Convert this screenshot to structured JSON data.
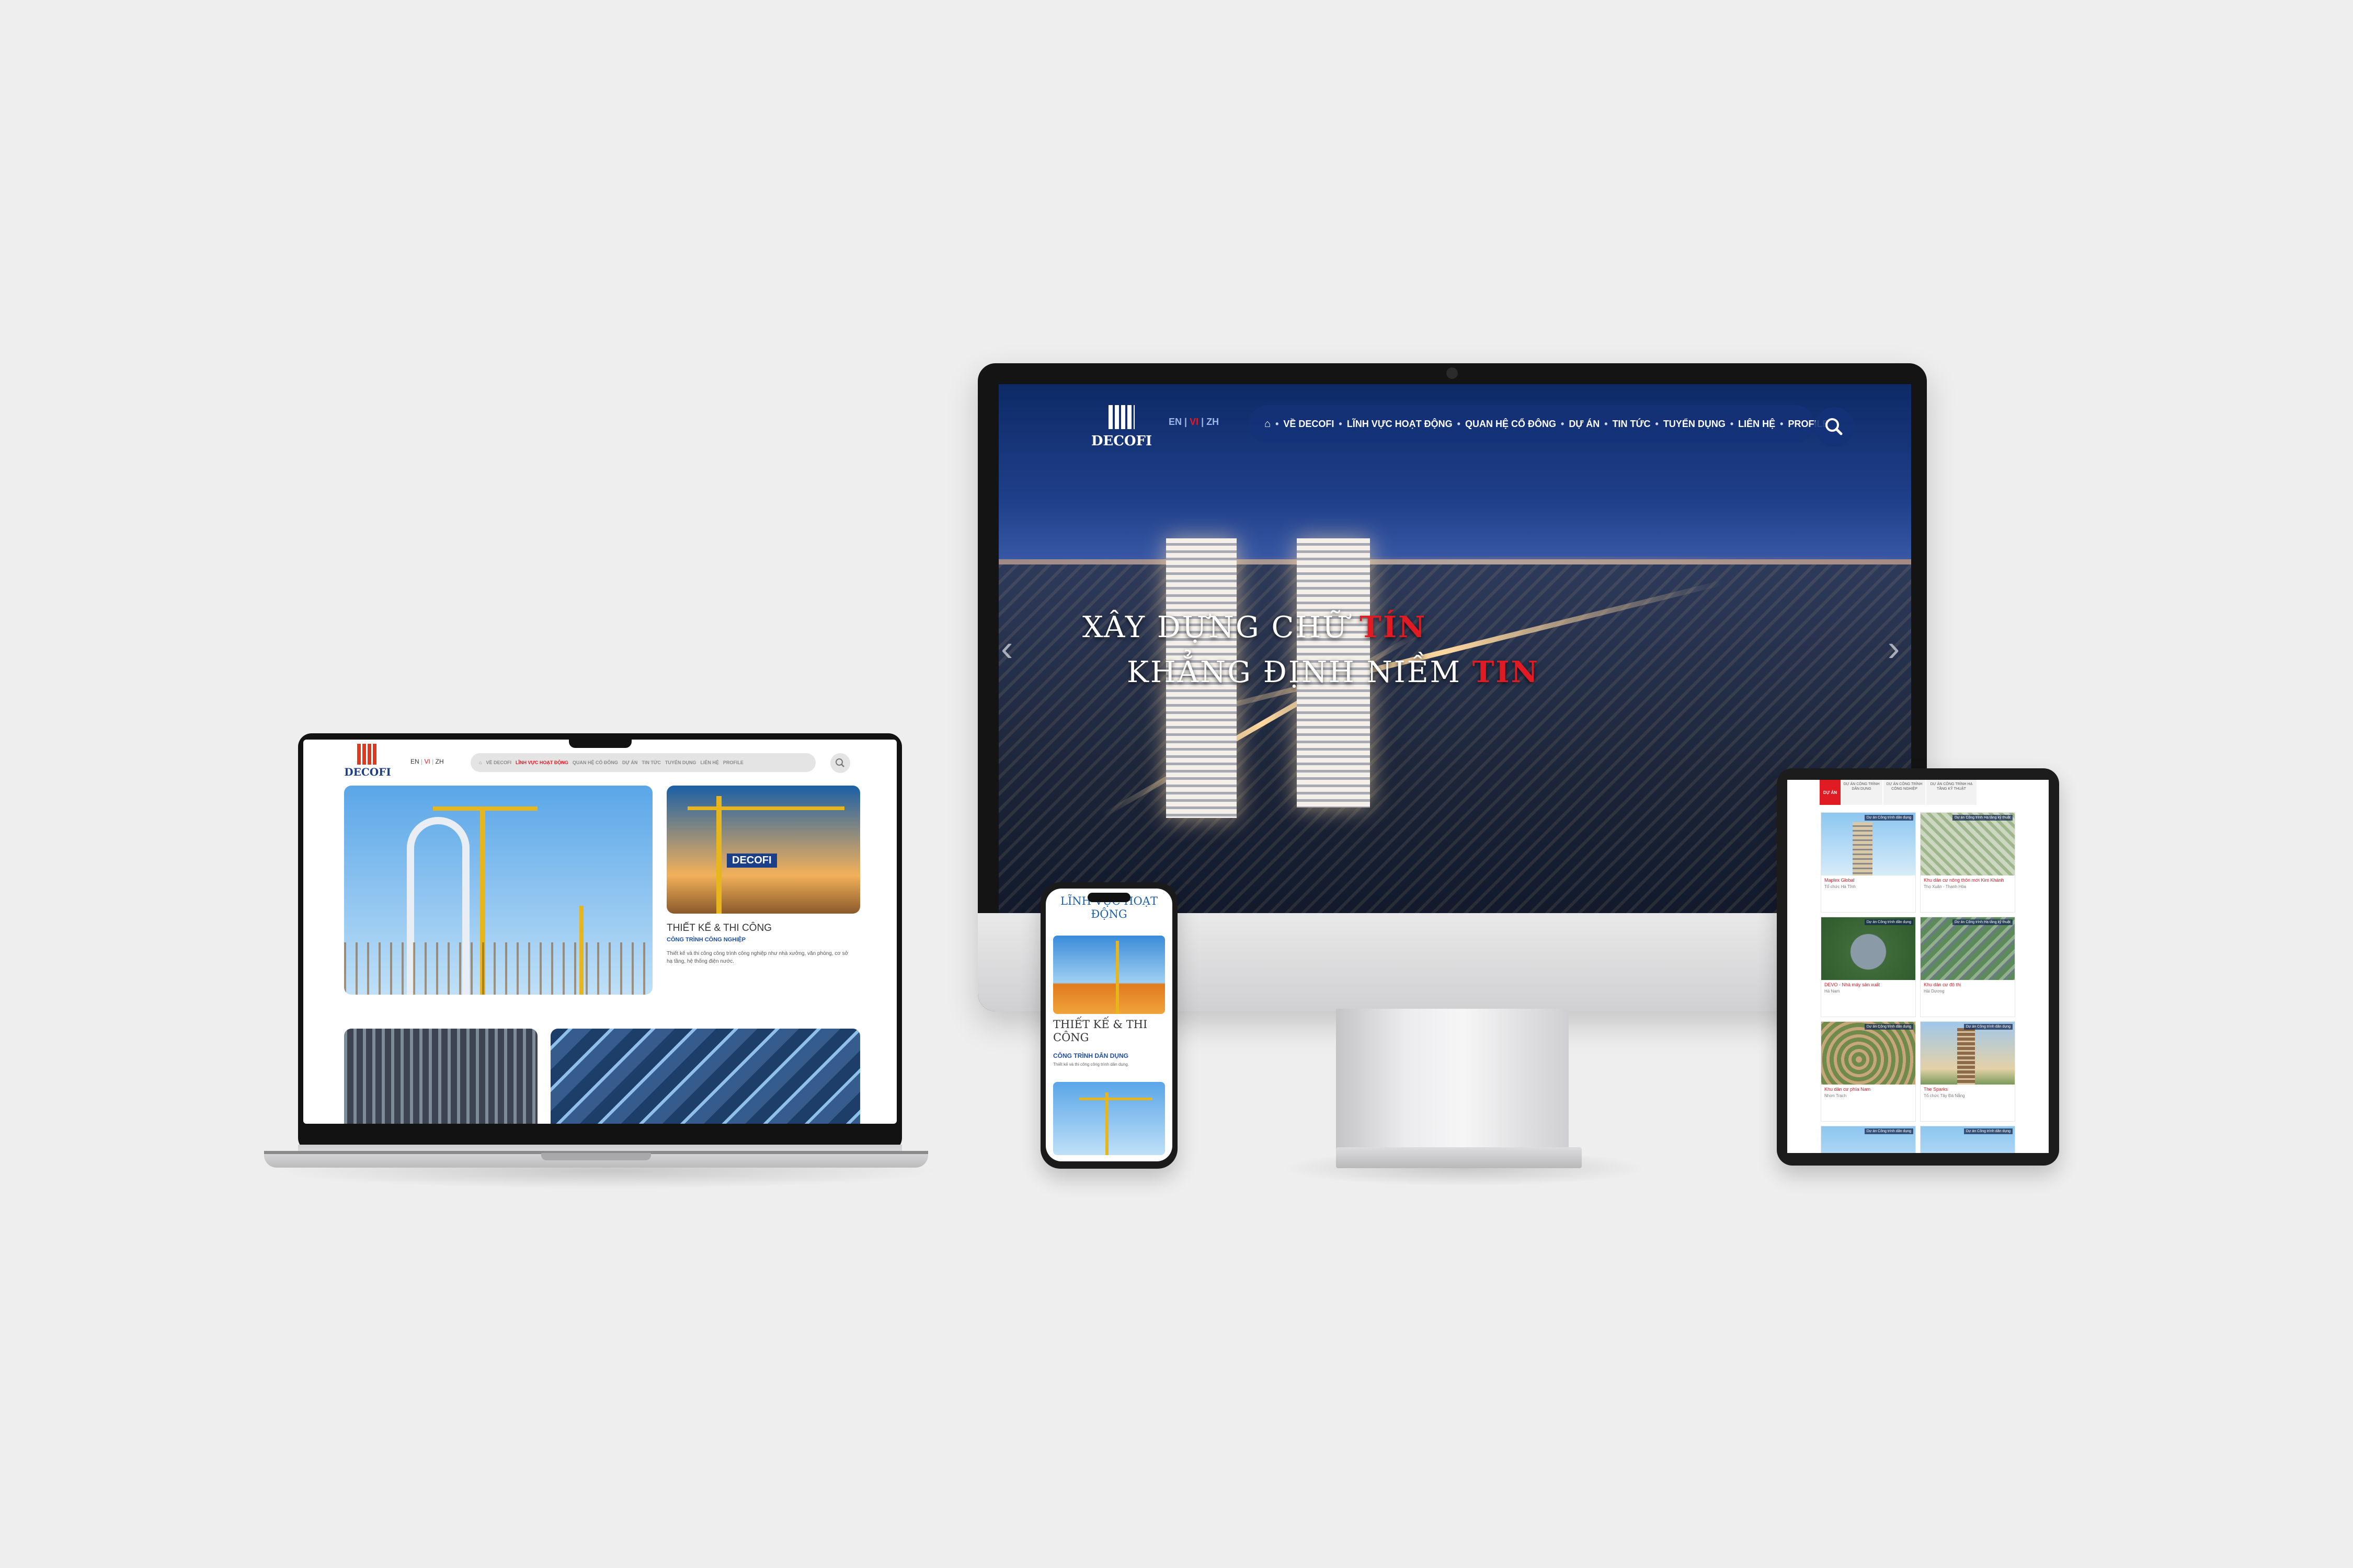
{
  "brand": {
    "name": "DECOFI",
    "accent": "#e01b24",
    "nav_blue": "#14327a"
  },
  "languages": [
    "EN",
    "VI",
    "ZH"
  ],
  "desktop": {
    "nav": [
      "VỀ DECOFI",
      "LĨNH VỰC HOẠT ĐỘNG",
      "QUAN HỆ CỔ ĐÔNG",
      "DỰ ÁN",
      "TIN TỨC",
      "TUYỂN DỤNG",
      "LIÊN HỆ",
      "PROFILE"
    ],
    "hero": {
      "line1_prefix": "XÂY DỰNG CHỮ ",
      "line1_highlight": "TÍN",
      "line2_prefix": "KHẲNG ĐỊNH NIỀM ",
      "line2_highlight": "TIN"
    },
    "prev_arrow": "‹",
    "next_arrow": "›"
  },
  "laptop": {
    "nav": [
      "VỀ DECOFI",
      "LĨNH VỰC HOẠT ĐỘNG",
      "QUAN HỆ CỔ ĐÔNG",
      "DỰ ÁN",
      "TIN TỨC",
      "TUYỂN DỤNG",
      "LIÊN HỆ",
      "PROFILE"
    ],
    "card_title": "THIẾT KẾ & THI CÔNG",
    "card_subtitle": "CÔNG TRÌNH CÔNG NGHIỆP",
    "card_text": "Thiết kế và thi công công trình công nghiệp như nhà xưởng, văn phòng, cơ sở hạ tầng, hệ thống điện nước.",
    "banner_text": "DECOFI"
  },
  "phone": {
    "section_title": "LĨNH VỰC HOẠT ĐỘNG",
    "card_title": "THIẾT KẾ & THI CÔNG",
    "card_subtitle": "CÔNG TRÌNH DÂN DỤNG",
    "card_text": "Thiết kế và thi công công trình dân dụng."
  },
  "tablet": {
    "tabs": [
      "DỰ ÁN",
      "DỰ ÁN CÔNG TRÌNH DÂN DỤNG",
      "DỰ ÁN CÔNG TRÌNH CÔNG NGHIỆP",
      "DỰ ÁN CÔNG TRÌNH HẠ TẦNG KỸ THUẬT"
    ],
    "cards": [
      {
        "tag": "Dự án Công trình dân dụng",
        "title": "Maplex Global",
        "sub": "Tổ chức Hà Tĩnh",
        "img": "tower"
      },
      {
        "tag": "Dự án Công trình Hạ tầng kỹ thuật",
        "title": "Khu dân cư nông thôn mới Kim Khánh",
        "sub": "Thọ Xuân - Thanh Hóa",
        "img": "aerial"
      },
      {
        "tag": "Dự án Công trình dân dụng",
        "title": "DEVO - Nhà máy sản xuất",
        "sub": "Hà Nam",
        "img": "green"
      },
      {
        "tag": "Dự án Công trình Hạ tầng kỹ thuật",
        "title": "Khu dân cư đô thị",
        "sub": "Hải Dương",
        "img": "aerial"
      },
      {
        "tag": "Dự án Công trình dân dụng",
        "title": "Khu dân cư phía Nam",
        "sub": "Nhơn Trạch",
        "img": "aerial"
      },
      {
        "tag": "Dự án Công trình dân dụng",
        "title": "The Sparks",
        "sub": "Tổ chức Tây Đà Nẵng",
        "img": "tower"
      },
      {
        "tag": "Dự án Công trình dân dụng",
        "title": "",
        "sub": "",
        "img": "tower"
      },
      {
        "tag": "Dự án Công trình dân dụng",
        "title": "",
        "sub": "",
        "img": "tower"
      }
    ]
  }
}
